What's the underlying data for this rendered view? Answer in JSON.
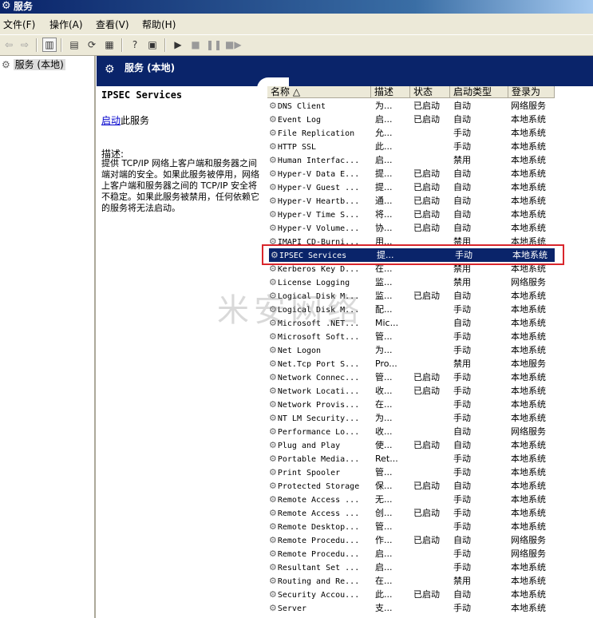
{
  "window": {
    "title": "服务",
    "icon": "gear-icon"
  },
  "menu": [
    "文件(F)",
    "操作(A)",
    "查看(V)",
    "帮助(H)"
  ],
  "toolbar": {
    "icons": [
      "back-arrow-icon",
      "forward-arrow-icon",
      "show-hide-tree-icon",
      "properties-icon",
      "refresh-icon",
      "export-list-icon",
      "help-icon",
      "view-icon",
      "start-icon",
      "stop-icon",
      "pause-icon",
      "restart-icon"
    ]
  },
  "tree": {
    "root_label": "服务 (本地)"
  },
  "header": {
    "title": "服务 (本地)"
  },
  "detail": {
    "service_name": "IPSEC Services",
    "action_link": "启动",
    "action_suffix": "此服务",
    "desc_label": "描述:",
    "desc_text": "提供 TCP/IP 网络上客户端和服务器之间端对端的安全。如果此服务被停用，网络上客户端和服务器之间的 TCP/IP 安全将不稳定。如果此服务被禁用，任何依赖它的服务将无法启动。"
  },
  "columns": [
    "名称 △",
    "描述",
    "状态",
    "启动类型",
    "登录为"
  ],
  "rows": [
    {
      "name": "DNS Client",
      "desc": "为...",
      "status": "已启动",
      "start": "自动",
      "logon": "网络服务"
    },
    {
      "name": "Event Log",
      "desc": "启...",
      "status": "已启动",
      "start": "自动",
      "logon": "本地系统"
    },
    {
      "name": "File Replication",
      "desc": "允...",
      "status": "",
      "start": "手动",
      "logon": "本地系统"
    },
    {
      "name": "HTTP SSL",
      "desc": "此...",
      "status": "",
      "start": "手动",
      "logon": "本地系统"
    },
    {
      "name": "Human Interfac...",
      "desc": "启...",
      "status": "",
      "start": "禁用",
      "logon": "本地系统"
    },
    {
      "name": "Hyper-V Data E...",
      "desc": "提...",
      "status": "已启动",
      "start": "自动",
      "logon": "本地系统"
    },
    {
      "name": "Hyper-V Guest ...",
      "desc": "提...",
      "status": "已启动",
      "start": "自动",
      "logon": "本地系统"
    },
    {
      "name": "Hyper-V Heartb...",
      "desc": "通...",
      "status": "已启动",
      "start": "自动",
      "logon": "本地系统"
    },
    {
      "name": "Hyper-V Time S...",
      "desc": "将...",
      "status": "已启动",
      "start": "自动",
      "logon": "本地系统"
    },
    {
      "name": "Hyper-V Volume...",
      "desc": "协...",
      "status": "已启动",
      "start": "自动",
      "logon": "本地系统"
    },
    {
      "name": "IMAPI CD-Burni...",
      "desc": "用...",
      "status": "",
      "start": "禁用",
      "logon": "本地系统"
    },
    {
      "name": "IPSEC Services",
      "desc": "提...",
      "status": "",
      "start": "手动",
      "logon": "本地系统",
      "selected": true
    },
    {
      "name": "Kerberos Key D...",
      "desc": "在...",
      "status": "",
      "start": "禁用",
      "logon": "本地系统"
    },
    {
      "name": "License Logging",
      "desc": "监...",
      "status": "",
      "start": "禁用",
      "logon": "网络服务"
    },
    {
      "name": "Logical Disk M...",
      "desc": "监...",
      "status": "已启动",
      "start": "自动",
      "logon": "本地系统"
    },
    {
      "name": "Logical Disk M...",
      "desc": "配...",
      "status": "",
      "start": "手动",
      "logon": "本地系统"
    },
    {
      "name": "Microsoft .NET...",
      "desc": "Mic...",
      "status": "",
      "start": "自动",
      "logon": "本地系统"
    },
    {
      "name": "Microsoft Soft...",
      "desc": "管...",
      "status": "",
      "start": "手动",
      "logon": "本地系统"
    },
    {
      "name": "Net Logon",
      "desc": "为...",
      "status": "",
      "start": "手动",
      "logon": "本地系统"
    },
    {
      "name": "Net.Tcp Port S...",
      "desc": "Pro...",
      "status": "",
      "start": "禁用",
      "logon": "本地服务"
    },
    {
      "name": "Network Connec...",
      "desc": "管...",
      "status": "已启动",
      "start": "手动",
      "logon": "本地系统"
    },
    {
      "name": "Network Locati...",
      "desc": "收...",
      "status": "已启动",
      "start": "手动",
      "logon": "本地系统"
    },
    {
      "name": "Network Provis...",
      "desc": "在...",
      "status": "",
      "start": "手动",
      "logon": "本地系统"
    },
    {
      "name": "NT LM Security...",
      "desc": "为...",
      "status": "",
      "start": "手动",
      "logon": "本地系统"
    },
    {
      "name": "Performance Lo...",
      "desc": "收...",
      "status": "",
      "start": "自动",
      "logon": "网络服务"
    },
    {
      "name": "Plug and Play",
      "desc": "使...",
      "status": "已启动",
      "start": "自动",
      "logon": "本地系统"
    },
    {
      "name": "Portable Media...",
      "desc": "Ret...",
      "status": "",
      "start": "手动",
      "logon": "本地系统"
    },
    {
      "name": "Print Spooler",
      "desc": "管...",
      "status": "",
      "start": "手动",
      "logon": "本地系统"
    },
    {
      "name": "Protected Storage",
      "desc": "保...",
      "status": "已启动",
      "start": "自动",
      "logon": "本地系统"
    },
    {
      "name": "Remote Access ...",
      "desc": "无...",
      "status": "",
      "start": "手动",
      "logon": "本地系统"
    },
    {
      "name": "Remote Access ...",
      "desc": "创...",
      "status": "已启动",
      "start": "手动",
      "logon": "本地系统"
    },
    {
      "name": "Remote Desktop...",
      "desc": "管...",
      "status": "",
      "start": "手动",
      "logon": "本地系统"
    },
    {
      "name": "Remote Procedu...",
      "desc": "作...",
      "status": "已启动",
      "start": "自动",
      "logon": "网络服务"
    },
    {
      "name": "Remote Procedu...",
      "desc": "启...",
      "status": "",
      "start": "手动",
      "logon": "网络服务"
    },
    {
      "name": "Resultant Set ...",
      "desc": "启...",
      "status": "",
      "start": "手动",
      "logon": "本地系统"
    },
    {
      "name": "Routing and Re...",
      "desc": "在...",
      "status": "",
      "start": "禁用",
      "logon": "本地系统"
    },
    {
      "name": "Security Accou...",
      "desc": "此...",
      "status": "已启动",
      "start": "自动",
      "logon": "本地系统"
    },
    {
      "name": "Server",
      "desc": "支...",
      "status": "",
      "start": "手动",
      "logon": "本地系统"
    }
  ],
  "watermark": "米安网络",
  "colors": {
    "header_blue": "#0a246a",
    "highlight_red": "#d9262c"
  }
}
